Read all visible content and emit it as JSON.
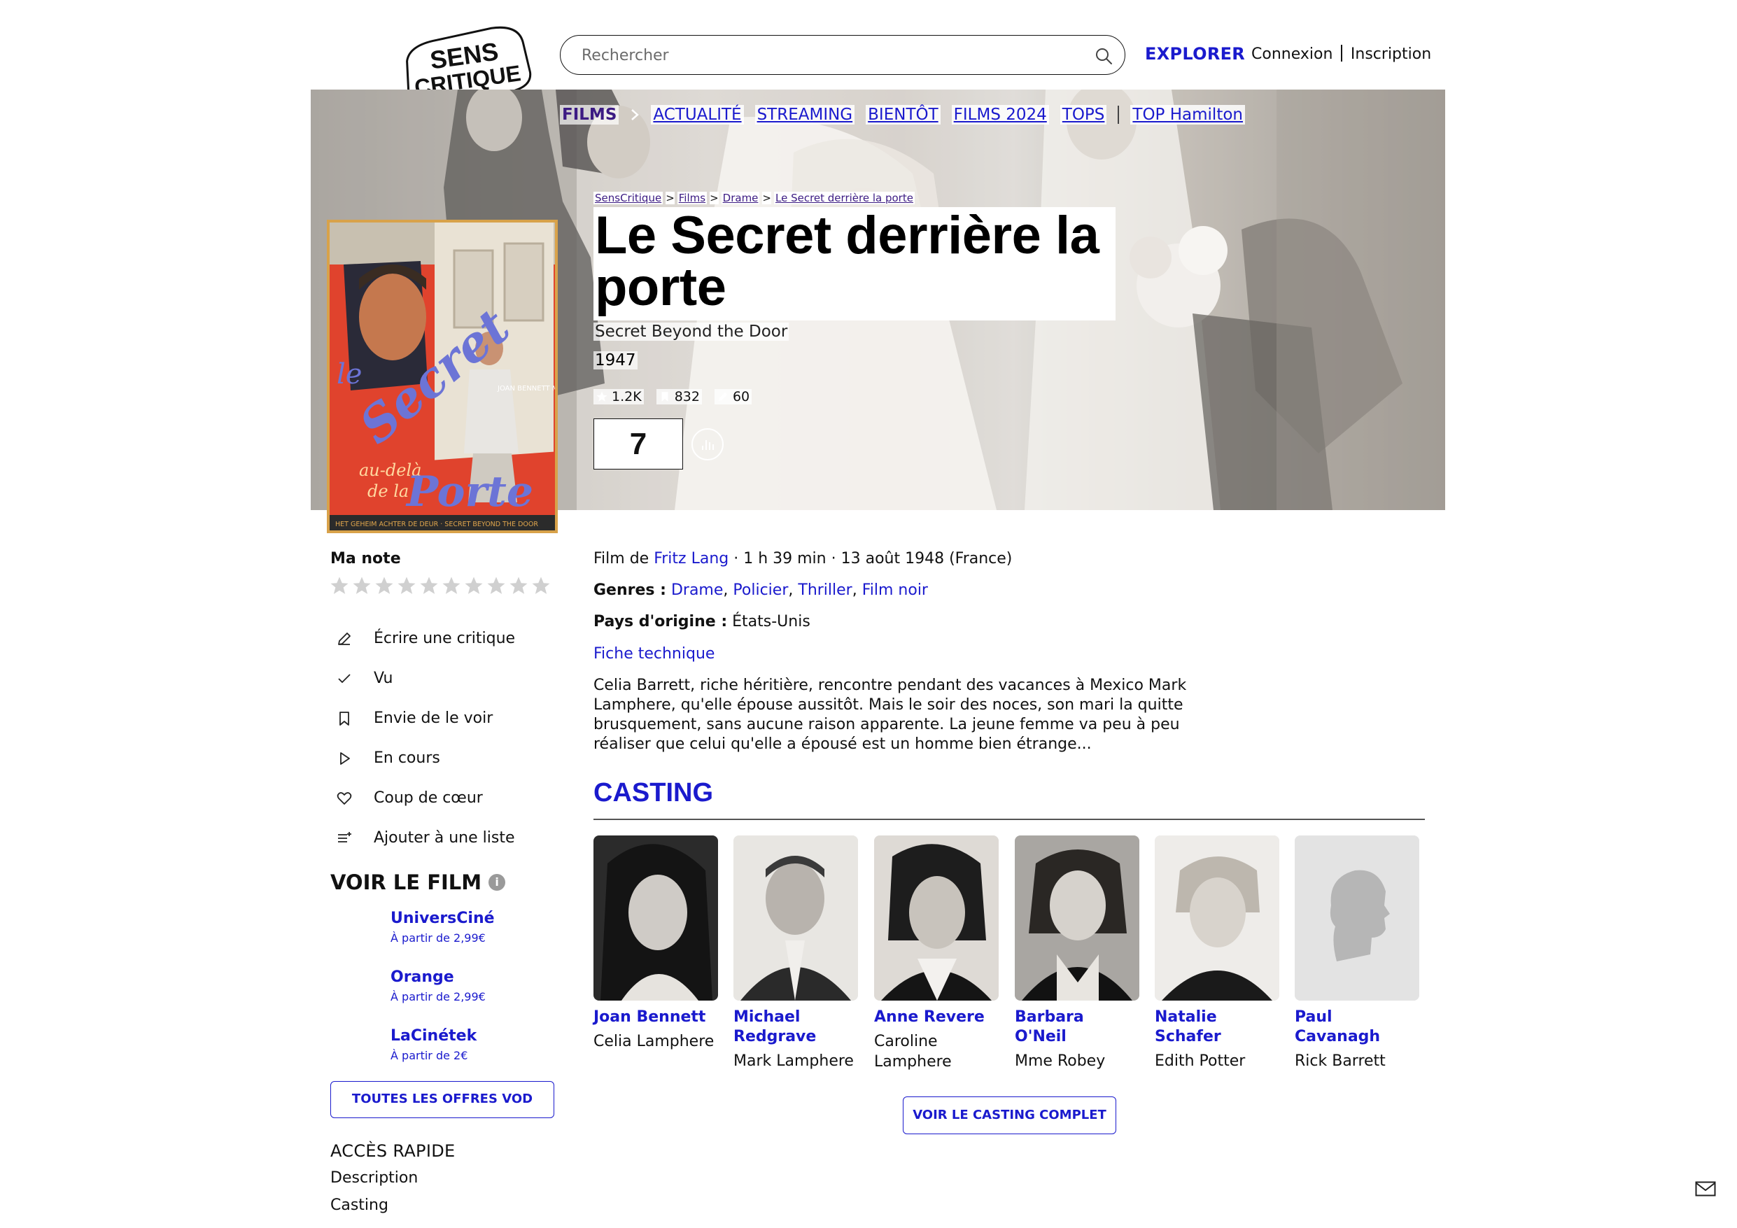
{
  "header": {
    "logo_line1": "SENS",
    "logo_line2": "CRITIQUE",
    "search_placeholder": "Rechercher",
    "explorer": "EXPLORER",
    "login": "Connexion",
    "signup": "Inscription"
  },
  "subnav": {
    "films": "FILMS",
    "items": [
      "ACTUALITÉ",
      "STREAMING",
      "BIENTÔT",
      "FILMS 2024",
      "TOPS"
    ],
    "top": "TOP Hamilton"
  },
  "breadcrumb": [
    "SensCritique",
    "Films",
    "Drame",
    "Le Secret derrière la porte"
  ],
  "film": {
    "title": "Le Secret derrière la porte",
    "original_title": "Secret Beyond the Door",
    "year": "1947",
    "ratings_count": "1.2K",
    "wishlist_count": "832",
    "reviews_count": "60",
    "score": "7",
    "director_prefix": "Film de",
    "director": "Fritz Lang",
    "duration_release": " · 1 h 39 min · 13 août 1948 (France)",
    "genres_label": "Genres :",
    "genres": [
      "Drame",
      "Policier",
      "Thriller",
      "Film noir"
    ],
    "country_label": "Pays d'origine :",
    "country": "États-Unis",
    "tech_sheet": "Fiche technique",
    "synopsis": "Celia Barrett, riche héritière, rencontre pendant des vacances à Mexico Mark Lamphere, qu'elle épouse aussitôt. Mais le soir des noces, son mari la quitte brusquement, sans aucune raison apparente. La jeune femme va peu à peu réaliser que celui qu'elle a épousé est un homme bien étrange..."
  },
  "poster": {
    "title_word1": "le",
    "title_word2": "Secret",
    "title_word3": "au-delà",
    "title_word4": "de la",
    "title_word5": "Porte",
    "credit": "JOAN BENNETT MICHAEL REDGRAVE",
    "bottom": "HET GEHEIM ACHTER DE DEUR · SECRET BEYOND THE DOOR"
  },
  "my_rating": {
    "label": "Ma note",
    "max": 10
  },
  "actions": [
    {
      "label": "Écrire une critique",
      "icon": "pencil-icon"
    },
    {
      "label": "Vu",
      "icon": "check-icon"
    },
    {
      "label": "Envie de le voir",
      "icon": "bookmark-icon"
    },
    {
      "label": "En cours",
      "icon": "play-icon"
    },
    {
      "label": "Coup de cœur",
      "icon": "heart-icon"
    },
    {
      "label": "Ajouter à une liste",
      "icon": "list-add-icon"
    }
  ],
  "watch": {
    "title": "VOIR LE FILM",
    "offers": [
      {
        "name": "UniversCiné",
        "price": "À partir de 2,99€"
      },
      {
        "name": "Orange",
        "price": "À partir de 2,99€"
      },
      {
        "name": "LaCinétek",
        "price": "À partir de 2€"
      }
    ],
    "all_offers": "TOUTES LES OFFRES VOD"
  },
  "quick_access": {
    "title": "ACCÈS RAPIDE",
    "items": [
      "Description",
      "Casting"
    ]
  },
  "casting": {
    "title": "CASTING",
    "members": [
      {
        "name": "Joan Bennett",
        "role": "Celia Lamphere"
      },
      {
        "name": "Michael Redgrave",
        "role": "Mark Lamphere"
      },
      {
        "name": "Anne Revere",
        "role": "Caroline Lamphere"
      },
      {
        "name": "Barbara O'Neil",
        "role": "Mme Robey"
      },
      {
        "name": "Natalie Schafer",
        "role": "Edith Potter"
      },
      {
        "name": "Paul Cavanagh",
        "role": "Rick Barrett"
      }
    ],
    "full_cast": "VOIR LE CASTING COMPLET"
  },
  "colors": {
    "accent": "#1a1acd",
    "films_nav": "#3c1b83",
    "poster_red": "#e0432d",
    "poster_border": "#d8a24a"
  }
}
